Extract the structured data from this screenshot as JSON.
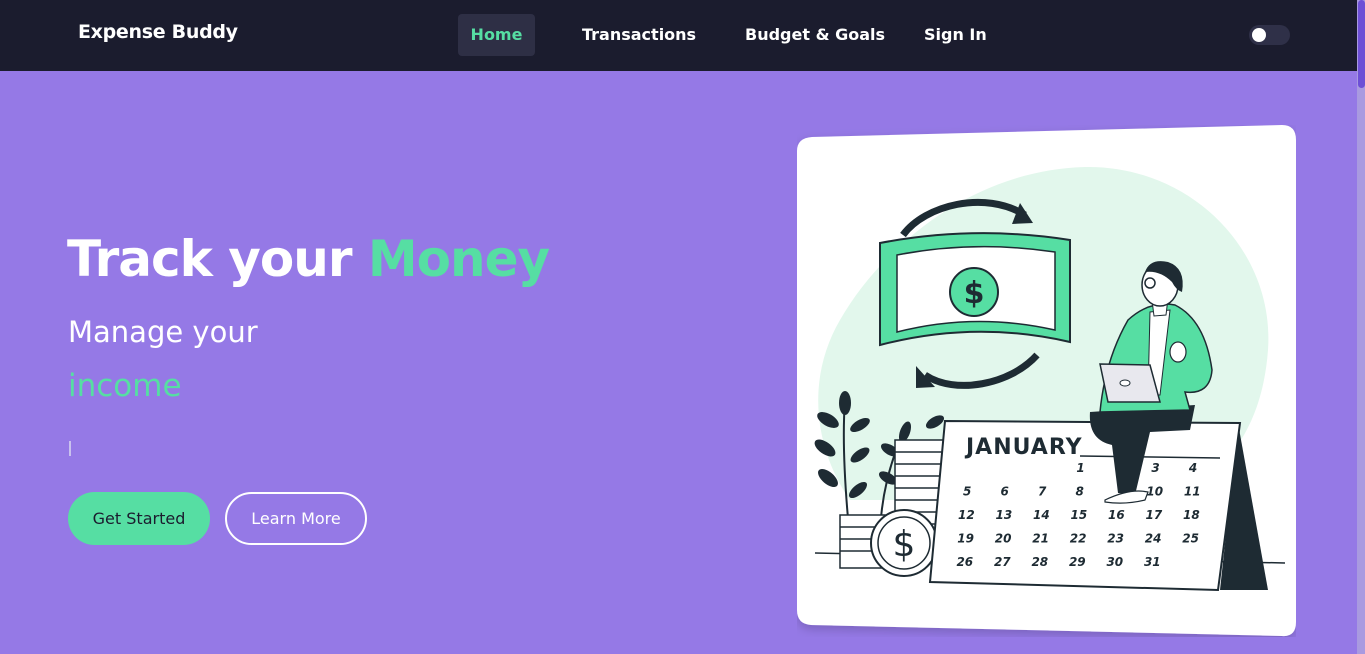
{
  "nav": {
    "brand": "Expense Buddy",
    "items": [
      {
        "label": "Home",
        "active": true
      },
      {
        "label": "Transactions",
        "active": false
      },
      {
        "label": "Budget & Goals",
        "active": false
      },
      {
        "label": "Sign In",
        "active": false
      }
    ],
    "theme_toggle": {
      "on": false
    }
  },
  "hero": {
    "title_part1": "Track your ",
    "title_accent": "Money",
    "subtitle": "Manage your",
    "typed_word": "income",
    "primary_button": "Get Started",
    "secondary_button": "Learn More"
  },
  "illustration": {
    "calendar_month": "JANUARY",
    "calendar_rows": [
      [
        "",
        "",
        "",
        "1",
        "",
        "3",
        "4"
      ],
      [
        "5",
        "6",
        "7",
        "8",
        "",
        "10",
        "11"
      ],
      [
        "12",
        "13",
        "14",
        "15",
        "16",
        "17",
        "18"
      ],
      [
        "19",
        "20",
        "21",
        "22",
        "23",
        "24",
        "25"
      ],
      [
        "26",
        "27",
        "28",
        "29",
        "30",
        "31",
        ""
      ]
    ],
    "currency_symbol": "$"
  },
  "colors": {
    "navbar": "#1b1c2e",
    "background": "#9579e6",
    "accent": "#56dea3",
    "dark": "#1e2b33"
  }
}
